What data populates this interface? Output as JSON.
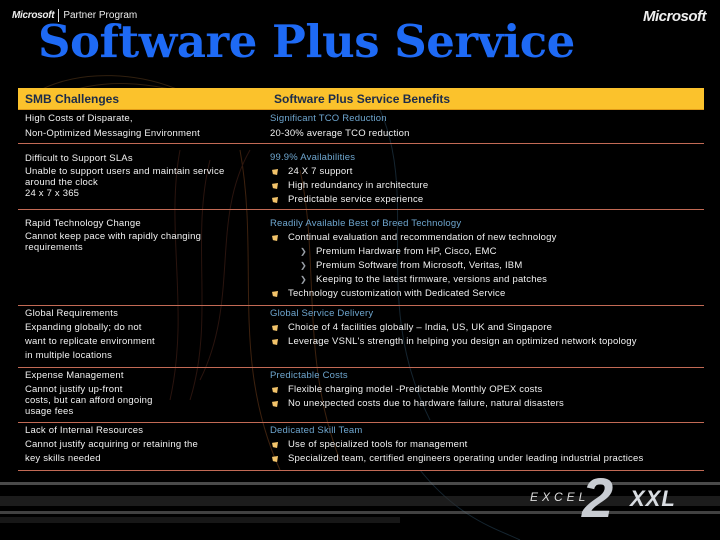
{
  "branding": {
    "partner_company": "Microsoft",
    "partner_program": "Partner Program",
    "corner_logo": "Microsoft",
    "footer_logo_left": "EXCEL",
    "footer_logo_number": "2",
    "footer_logo_right": "XXL"
  },
  "title": "Software Plus Service",
  "table": {
    "headers": {
      "left": "SMB Challenges",
      "right": "Software Plus Service Benefits"
    },
    "colors": {
      "header_bg": "#fbc22c",
      "header_text": "#1c2c4a",
      "subheading": "#6ea6cf",
      "title": "#1e6af5",
      "divider": "#c26a55",
      "bullet": "#f2c36a"
    },
    "rows": [
      {
        "left": [
          "High Costs of Disparate,",
          "Non-Optimized Messaging Environment"
        ],
        "right_heading": "Significant TCO  Reduction",
        "right_plain": [
          "20-30% average TCO reduction"
        ],
        "bullets": []
      },
      {
        "left": [
          "Difficult to Support SLAs",
          "Unable to support users and maintain service",
          "around the clock",
          "24 x 7 x 365"
        ],
        "right_heading": "99.9% Availabilities",
        "bullets": [
          "24 X 7 support",
          "High redundancy in architecture",
          "Predictable service experience"
        ]
      },
      {
        "left": [
          "Rapid Technology Change",
          "Cannot keep pace with rapidly changing",
          "requirements"
        ],
        "right_heading": "Readily Available Best of Breed Technology",
        "bullets": [
          "Continual evaluation and recommendation of new technology",
          "Technology customization with Dedicated Service"
        ],
        "sub_bullets": [
          "Premium Hardware from HP, Cisco, EMC",
          "Premium Software from Microsoft, Veritas, IBM",
          "Keeping to the latest firmware, versions and patches"
        ]
      },
      {
        "left": [
          "Global Requirements",
          "Expanding globally; do not",
          "want to replicate environment",
          "in multiple locations"
        ],
        "right_heading": "Global Service Delivery",
        "bullets": [
          "Choice of 4 facilities globally – India, US, UK and Singapore",
          "Leverage VSNL's strength in helping you design an optimized network topology"
        ]
      },
      {
        "left": [
          "Expense Management",
          "Cannot justify up-front",
          "costs, but can afford ongoing",
          "usage fees"
        ],
        "right_heading": "Predictable Costs",
        "bullets": [
          "Flexible charging model -Predictable Monthly OPEX costs",
          "No unexpected costs due to hardware failure, natural disasters"
        ]
      },
      {
        "left": [
          "Lack of Internal Resources",
          "Cannot justify acquiring or retaining the",
          "key skills needed"
        ],
        "right_heading": "Dedicated Skill Team",
        "bullets": [
          "Use of specialized tools for management",
          "Specialized team, certified engineers operating under leading industrial practices"
        ]
      }
    ]
  },
  "icons": {
    "bullet": "square-bullet-icon",
    "sub_bullet": "chevron-right-icon"
  }
}
